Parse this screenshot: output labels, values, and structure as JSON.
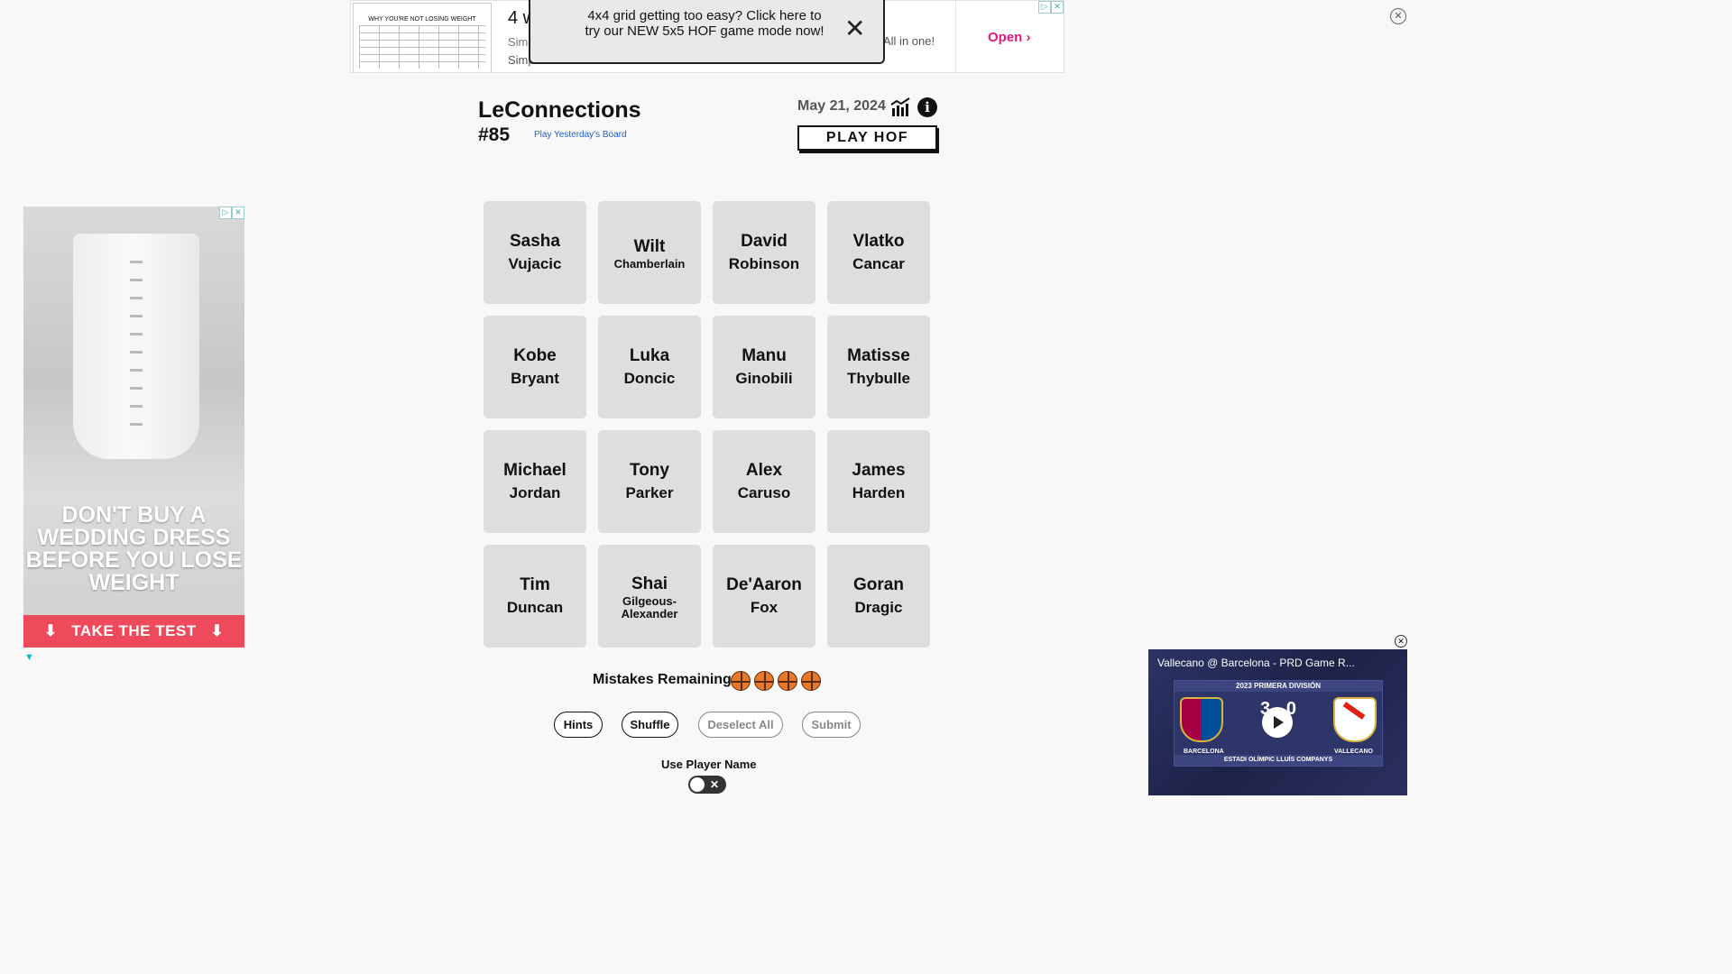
{
  "top_ad": {
    "thumb_title": "WHY YOU'RE NOT LOSING WEIGHT",
    "headline": "4 w",
    "line1": "Simp",
    "line2": "Simp",
    "tagline": "All in one!",
    "open_label": "Open",
    "popup_text": "4x4 grid getting too easy? Click here to try our NEW 5x5 HOF game mode now!"
  },
  "header": {
    "title": "LeConnections",
    "puzzle_number": "#85",
    "yesterday_link": "Play Yesterday's Board",
    "date": "May 21, 2024",
    "play_hof_label": "PLAY HOF"
  },
  "board": {
    "tiles": [
      {
        "first": "Sasha",
        "last": "Vujacic"
      },
      {
        "first": "Wilt",
        "last": "Chamberlain"
      },
      {
        "first": "David",
        "last": "Robinson"
      },
      {
        "first": "Vlatko",
        "last": "Cancar"
      },
      {
        "first": "Kobe",
        "last": "Bryant"
      },
      {
        "first": "Luka",
        "last": "Doncic"
      },
      {
        "first": "Manu",
        "last": "Ginobili"
      },
      {
        "first": "Matisse",
        "last": "Thybulle"
      },
      {
        "first": "Michael",
        "last": "Jordan"
      },
      {
        "first": "Tony",
        "last": "Parker"
      },
      {
        "first": "Alex",
        "last": "Caruso"
      },
      {
        "first": "James",
        "last": "Harden"
      },
      {
        "first": "Tim",
        "last": "Duncan"
      },
      {
        "first": "Shai",
        "last": "Gilgeous-Alexander"
      },
      {
        "first": "De'Aaron",
        "last": "Fox"
      },
      {
        "first": "Goran",
        "last": "Dragic"
      }
    ]
  },
  "left_ad": {
    "headline": "DON'T BUY A WEDDING DRESS BEFORE YOU LOSE WEIGHT",
    "cta": "TAKE THE TEST"
  },
  "controls": {
    "mistakes_label": "Mistakes Remaining:",
    "mistakes_remaining": 4,
    "hints": "Hints",
    "shuffle": "Shuffle",
    "deselect_all": "Deselect All",
    "submit": "Submit",
    "toggle_label": "Use Player Name",
    "toggle_on": false
  },
  "video_ad": {
    "title": "Vallecano @ Barcelona - PRD Game R...",
    "league": "2023 PRIMERA DIVISIÓN",
    "score": "3 - 0",
    "home_team": "BARCELONA",
    "away_team": "VALLECANO",
    "venue": "ESTADI OLÍMPIC LLUÍS COMPANYS"
  },
  "colors": {
    "tile_bg": "#dedede",
    "link_blue": "#1e5fd0",
    "ad_pink": "#e0197a",
    "cta_red": "#ef4a5b"
  }
}
